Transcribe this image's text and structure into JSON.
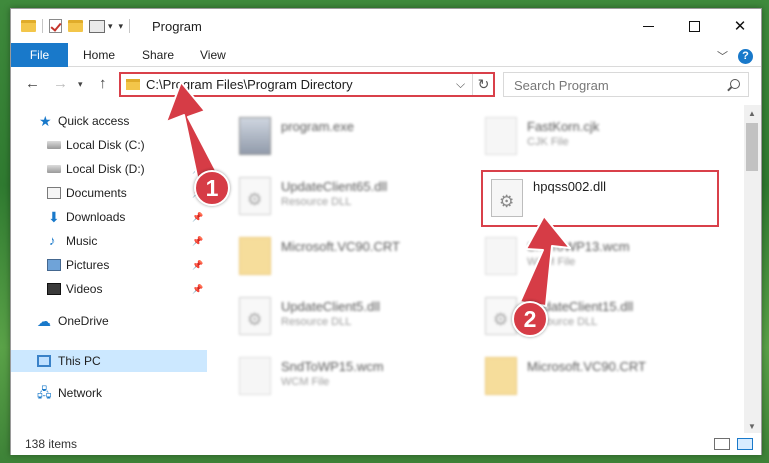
{
  "window": {
    "title": "Program"
  },
  "ribbon": {
    "file": "File",
    "tabs": [
      "Home",
      "Share",
      "View"
    ]
  },
  "address": {
    "path": "C:\\Program Files\\Program Directory"
  },
  "search": {
    "placeholder": "Search Program"
  },
  "sidebar": {
    "items": [
      {
        "label": "Quick access",
        "icon": "star-icon"
      },
      {
        "label": "Local Disk (C:)",
        "icon": "disk-icon",
        "pinned": true
      },
      {
        "label": "Local Disk (D:)",
        "icon": "disk-icon",
        "pinned": true
      },
      {
        "label": "Documents",
        "icon": "documents-icon",
        "pinned": true
      },
      {
        "label": "Downloads",
        "icon": "downloads-icon",
        "pinned": true
      },
      {
        "label": "Music",
        "icon": "music-icon",
        "pinned": true
      },
      {
        "label": "Pictures",
        "icon": "pictures-icon",
        "pinned": true
      },
      {
        "label": "Videos",
        "icon": "videos-icon",
        "pinned": true
      },
      {
        "label": "OneDrive",
        "icon": "onedrive-icon"
      },
      {
        "label": "This PC",
        "icon": "pc-icon",
        "selected": true
      },
      {
        "label": "Network",
        "icon": "network-icon"
      }
    ]
  },
  "files": [
    {
      "name": "program.exe",
      "type": ""
    },
    {
      "name": "FastKorn.cjk",
      "type": "CJK File"
    },
    {
      "name": "UpdateClient65.dll",
      "type": "Resource DLL"
    },
    {
      "name": "hpqss002.dll",
      "type": ""
    },
    {
      "name": "Microsoft.VC90.CRT",
      "type": ""
    },
    {
      "name": "SndToWP13.wcm",
      "type": "WCM File"
    },
    {
      "name": "UpdateClient5.dll",
      "type": "Resource DLL"
    },
    {
      "name": "UpdateClient15.dll",
      "type": "Resource DLL"
    },
    {
      "name": "SndToWP15.wcm",
      "type": "WCM File"
    },
    {
      "name": "Microsoft.VC90.CRT",
      "type": ""
    }
  ],
  "status": {
    "count": "138 items"
  },
  "annotations": {
    "step1": "1",
    "step2": "2",
    "color": "#d63c46"
  }
}
